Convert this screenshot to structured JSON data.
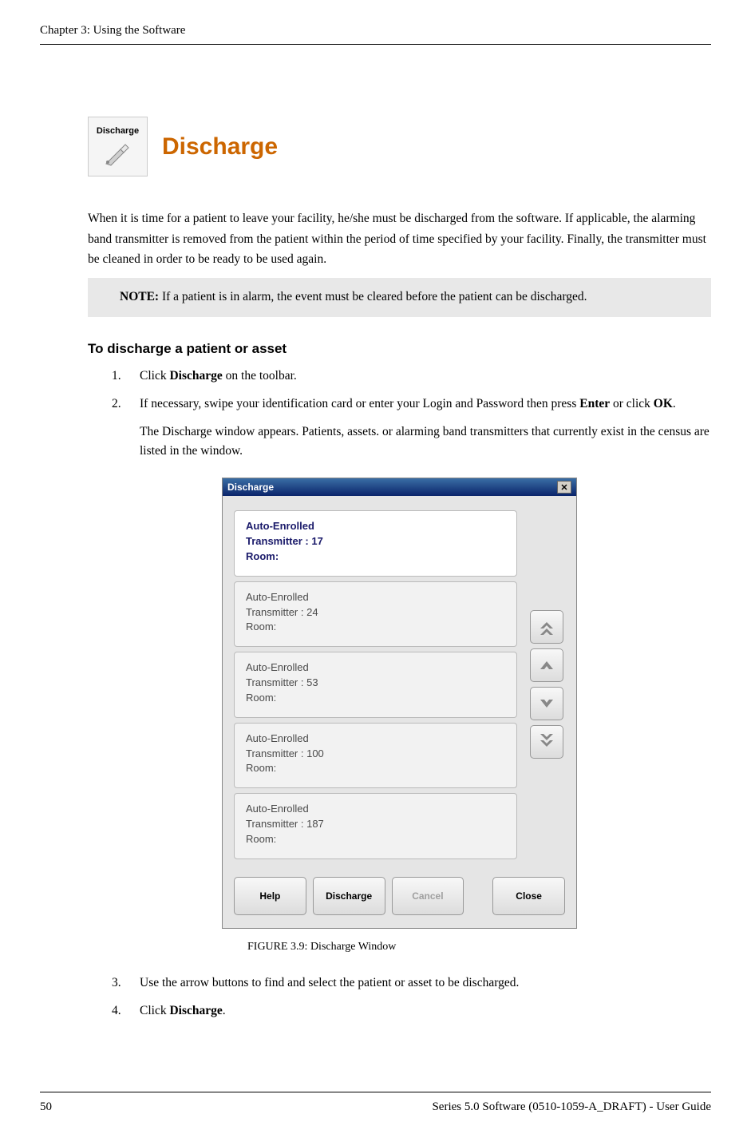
{
  "header": {
    "chapter": "Chapter 3: Using the Software"
  },
  "section": {
    "icon_label": "Discharge",
    "title": "Discharge",
    "intro": "When it is time for a patient to leave your facility, he/she must be discharged from the software. If applicable, the alarming band transmitter is removed from the patient within the period of time specified by your facility. Finally, the transmitter must be cleaned in order to be ready to be used again.",
    "note_label": "NOTE:",
    "note_text": " If a patient is in alarm, the event must be cleared before the patient can be discharged.",
    "subsection_title": "To discharge a patient or asset",
    "steps": [
      {
        "num": "1.",
        "pre": "Click ",
        "bold": "Discharge",
        "post": " on the toolbar."
      },
      {
        "num": "2.",
        "pre": "If necessary, swipe your identification card or enter your Login and Password then press ",
        "bold": "Enter",
        "mid": " or click ",
        "bold2": "OK",
        "post": ".",
        "sub": "The Discharge window appears. Patients, assets. or alarming band transmitters that currently exist in the census are listed in the window."
      },
      {
        "num": "3.",
        "pre": "Use the arrow buttons to find and select the patient or asset to be discharged.",
        "bold": "",
        "post": ""
      },
      {
        "num": "4.",
        "pre": "Click ",
        "bold": "Discharge",
        "post": "."
      }
    ]
  },
  "dialog": {
    "title": "Discharge",
    "items": [
      {
        "line1": "Auto-Enrolled",
        "line2": "Transmitter : 17",
        "line3": "Room:",
        "selected": true
      },
      {
        "line1": "Auto-Enrolled",
        "line2": "Transmitter : 24",
        "line3": "Room:",
        "selected": false
      },
      {
        "line1": "Auto-Enrolled",
        "line2": "Transmitter : 53",
        "line3": "Room:",
        "selected": false
      },
      {
        "line1": "Auto-Enrolled",
        "line2": "Transmitter : 100",
        "line3": "Room:",
        "selected": false
      },
      {
        "line1": "Auto-Enrolled",
        "line2": "Transmitter : 187",
        "line3": "Room:",
        "selected": false
      }
    ],
    "buttons": {
      "help": "Help",
      "discharge": "Discharge",
      "cancel": "Cancel",
      "close": "Close"
    }
  },
  "figure_caption": "FIGURE 3.9:    Discharge Window",
  "footer": {
    "page": "50",
    "guide": "Series 5.0 Software (0510-1059-A_DRAFT) - User Guide"
  }
}
